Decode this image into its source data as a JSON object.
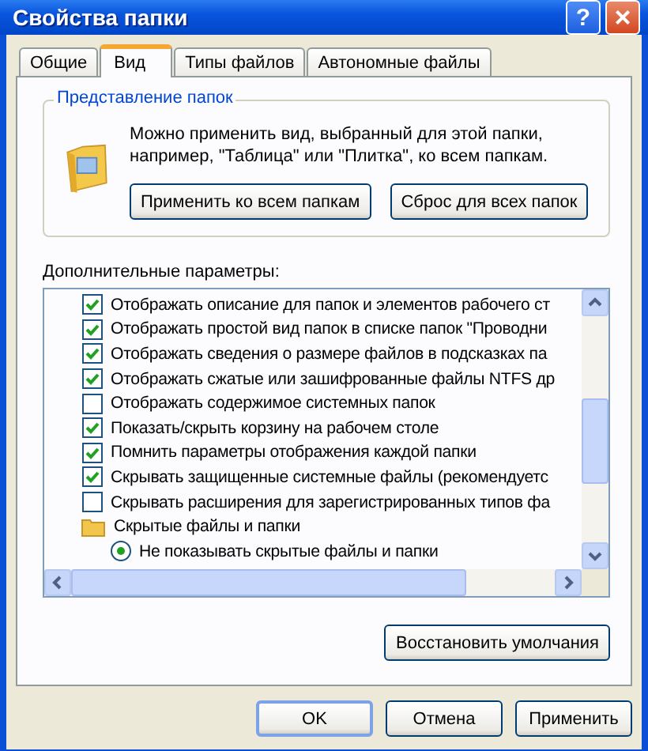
{
  "window": {
    "title": "Свойства папки",
    "help_button": "?",
    "close_button": "×"
  },
  "tabs": [
    {
      "label": "Общие",
      "selected": false
    },
    {
      "label": "Вид",
      "selected": true
    },
    {
      "label": "Типы файлов",
      "selected": false
    },
    {
      "label": "Автономные файлы",
      "selected": false
    }
  ],
  "folder_views": {
    "title": "Представление папок",
    "description": "Можно применить вид, выбранный для этой папки, например, \"Таблица\" или \"Плитка\", ко всем папкам.",
    "buttons": [
      "Применить ко всем папкам",
      "Сброс для всех папок"
    ]
  },
  "advanced": {
    "label": "Дополнительные параметры:",
    "items": [
      {
        "kind": "checkbox",
        "label": "Отображать описание для папок и элементов рабочего ст",
        "checked": true
      },
      {
        "kind": "checkbox",
        "label": "Отображать простой вид папок в списке папок \"Проводни",
        "checked": true
      },
      {
        "kind": "checkbox",
        "label": "Отображать сведения о размере файлов в подсказках па",
        "checked": true
      },
      {
        "kind": "checkbox",
        "label": "Отображать сжатые или зашифрованные файлы NTFS др",
        "checked": true
      },
      {
        "kind": "checkbox",
        "label": "Отображать содержимое системных папок",
        "checked": false
      },
      {
        "kind": "checkbox",
        "label": "Показать/скрыть корзину на рабочем столе",
        "checked": true
      },
      {
        "kind": "checkbox",
        "label": "Помнить параметры отображения каждой папки",
        "checked": true
      },
      {
        "kind": "checkbox",
        "label": "Скрывать защищенные системные файлы (рекомендуетс",
        "checked": true
      },
      {
        "kind": "checkbox",
        "label": "Скрывать расширения для зарегистрированных типов фа",
        "checked": false
      },
      {
        "kind": "folder",
        "label": "Скрытые файлы и папки",
        "children": [
          {
            "kind": "radio",
            "label": "Не показывать скрытые файлы и папки",
            "selected": true
          }
        ]
      }
    ],
    "restore_button": "Восстановить умолчания"
  },
  "buttons": [
    "OK",
    "Отмена",
    "Применить"
  ]
}
